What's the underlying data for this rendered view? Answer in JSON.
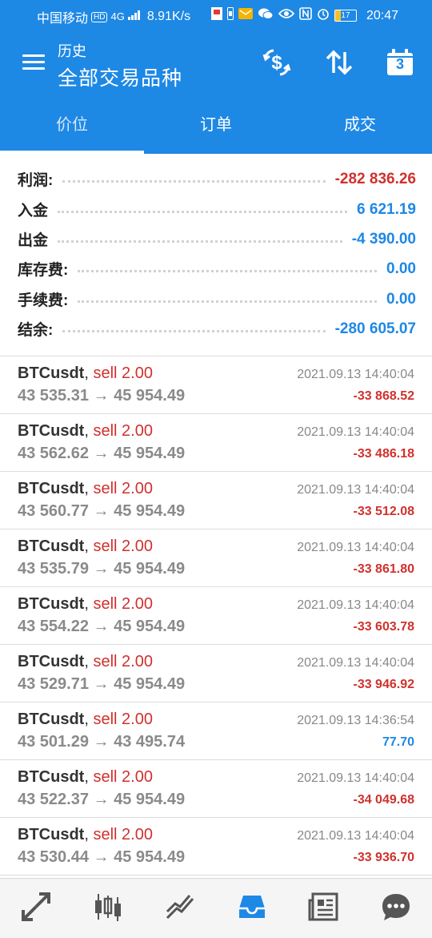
{
  "status_bar": {
    "carrier": "中国移动",
    "hd": "HD",
    "network": "4G",
    "speed": "8.91K/s",
    "battery": "17",
    "time": "20:47"
  },
  "app_bar": {
    "subtitle": "历史",
    "title": "全部交易品种",
    "calendar_day": "3"
  },
  "tabs": [
    {
      "label": "价位",
      "active": true
    },
    {
      "label": "订单",
      "active": false
    },
    {
      "label": "成交",
      "active": false
    }
  ],
  "summary": [
    {
      "label": "利润:",
      "value": "-282 836.26",
      "color": "#d0312d"
    },
    {
      "label": "入金",
      "value": "6 621.19",
      "color": "#1e88e5"
    },
    {
      "label": "出金",
      "value": "-4 390.00",
      "color": "#1e88e5"
    },
    {
      "label": "库存费:",
      "value": "0.00",
      "color": "#1e88e5"
    },
    {
      "label": "手续费:",
      "value": "0.00",
      "color": "#1e88e5"
    },
    {
      "label": "结余:",
      "value": "-280 605.07",
      "color": "#1e88e5"
    }
  ],
  "deals": [
    {
      "symbol": "BTCusdt",
      "side": "sell 2.00",
      "open": "43 535.31",
      "close": "45 954.49",
      "time": "2021.09.13 14:40:04",
      "profit": "-33 868.52",
      "profit_color": "#d0312d"
    },
    {
      "symbol": "BTCusdt",
      "side": "sell 2.00",
      "open": "43 562.62",
      "close": "45 954.49",
      "time": "2021.09.13 14:40:04",
      "profit": "-33 486.18",
      "profit_color": "#d0312d"
    },
    {
      "symbol": "BTCusdt",
      "side": "sell 2.00",
      "open": "43 560.77",
      "close": "45 954.49",
      "time": "2021.09.13 14:40:04",
      "profit": "-33 512.08",
      "profit_color": "#d0312d"
    },
    {
      "symbol": "BTCusdt",
      "side": "sell 2.00",
      "open": "43 535.79",
      "close": "45 954.49",
      "time": "2021.09.13 14:40:04",
      "profit": "-33 861.80",
      "profit_color": "#d0312d"
    },
    {
      "symbol": "BTCusdt",
      "side": "sell 2.00",
      "open": "43 554.22",
      "close": "45 954.49",
      "time": "2021.09.13 14:40:04",
      "profit": "-33 603.78",
      "profit_color": "#d0312d"
    },
    {
      "symbol": "BTCusdt",
      "side": "sell 2.00",
      "open": "43 529.71",
      "close": "45 954.49",
      "time": "2021.09.13 14:40:04",
      "profit": "-33 946.92",
      "profit_color": "#d0312d"
    },
    {
      "symbol": "BTCusdt",
      "side": "sell 2.00",
      "open": "43 501.29",
      "close": "43 495.74",
      "time": "2021.09.13 14:36:54",
      "profit": "77.70",
      "profit_color": "#1e88e5"
    },
    {
      "symbol": "BTCusdt",
      "side": "sell 2.00",
      "open": "43 522.37",
      "close": "45 954.49",
      "time": "2021.09.13 14:40:04",
      "profit": "-34 049.68",
      "profit_color": "#d0312d"
    },
    {
      "symbol": "BTCusdt",
      "side": "sell 2.00",
      "open": "43 530.44",
      "close": "45 954.49",
      "time": "2021.09.13 14:40:04",
      "profit": "-33 936.70",
      "profit_color": "#d0312d"
    }
  ],
  "bottom_nav": [
    {
      "icon": "trade-arrows-icon",
      "active": false
    },
    {
      "icon": "candlestick-chart-icon",
      "active": false
    },
    {
      "icon": "trend-line-icon",
      "active": false
    },
    {
      "icon": "inbox-tray-icon",
      "active": true
    },
    {
      "icon": "news-icon",
      "active": false
    },
    {
      "icon": "chat-bubble-icon",
      "active": false
    }
  ],
  "colors": {
    "accent": "#1e88e5",
    "loss": "#d0312d",
    "nav_inactive": "#555555"
  }
}
